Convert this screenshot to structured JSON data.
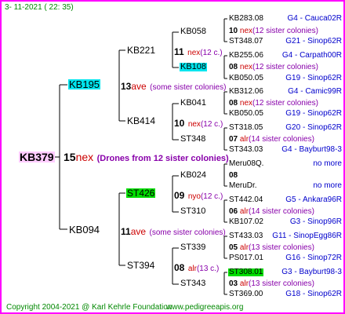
{
  "header": {
    "timestamp": "3- 11-2021 ( 22: 35)"
  },
  "footer": {
    "copyright": "Copyright 2004-2021 @ Karl Kehrle Foundation",
    "url": "www.pedigreeapis.org"
  },
  "root": {
    "id": "KB379",
    "gen_num": "15",
    "gen_suffix": "nex",
    "note": "(Drones from 12 sister colonies)"
  },
  "parents": [
    {
      "id": "KB195",
      "gen_num": "13",
      "gen_suffix": "ave",
      "note": "(some sister colonies)"
    },
    {
      "id": "KB094",
      "gen_num": "11",
      "gen_suffix": "ave",
      "note": "(some sister colonies)"
    }
  ],
  "gp": [
    {
      "id": "KB221",
      "gen_num": "11",
      "gen_suffix": "nex",
      "note": "(12 c.)"
    },
    {
      "id": "KB414",
      "gen_num": "10",
      "gen_suffix": "nex",
      "note": "(12 c.)"
    },
    {
      "id": "ST426",
      "gen_num": "09",
      "gen_suffix": "nyo",
      "note": "(12 c.)"
    },
    {
      "id": "ST394",
      "gen_num": "08",
      "gen_suffix": "alr",
      "note": "(13 c.)"
    }
  ],
  "ggp": [
    {
      "id": "KB058",
      "gen_num": "10",
      "gen_suffix": "nex",
      "note": "(12 sister colonies)"
    },
    {
      "id": "KB108",
      "gen_num": "08",
      "gen_suffix": "nex",
      "note": "(12 sister colonies)"
    },
    {
      "id": "KB041",
      "gen_num": "08",
      "gen_suffix": "nex",
      "note": "(12 sister colonies)"
    },
    {
      "id": "ST348",
      "gen_num": "07",
      "gen_suffix": "alr",
      "note": "(14 sister colonies)"
    },
    {
      "id": "KB024",
      "gen_num": "08",
      "gen_suffix": "",
      "note": ""
    },
    {
      "id": "ST310",
      "gen_num": "06",
      "gen_suffix": "alr",
      "note": "(14 sister colonies)"
    },
    {
      "id": "ST339",
      "gen_num": "05",
      "gen_suffix": "alr",
      "note": "(13 sister colonies)"
    },
    {
      "id": "ST343",
      "gen_num": "03",
      "gen_suffix": "alr",
      "note": "(13 sister colonies)"
    }
  ],
  "g4": [
    {
      "id": "KB283.08",
      "info": "G4 - Cauca02R"
    },
    {
      "id": "ST348.07",
      "info": "G21 - Sinop62R"
    },
    {
      "id": "KB255.06",
      "info": "G4 - Carpath00R"
    },
    {
      "id": "KB050.05",
      "info": "G19 - Sinop62R"
    },
    {
      "id": "KB312.06",
      "info": "G4 - Camic99R"
    },
    {
      "id": "KB050.05",
      "info": "G19 - Sinop62R"
    },
    {
      "id": "ST318.05",
      "info": "G20 - Sinop62R"
    },
    {
      "id": "ST343.03",
      "info": "G4 - Bayburt98-3"
    },
    {
      "id": "Meru08Q.",
      "info": "no more"
    },
    {
      "id": "MeruDr.",
      "info": "no more"
    },
    {
      "id": "ST442.04",
      "info": "G5 - Ankara96R"
    },
    {
      "id": "KB107.02",
      "info": "G3 - Sinop96R"
    },
    {
      "id": "ST433.03",
      "info": "G11 - SinopEgg86R"
    },
    {
      "id": "PS017.01",
      "info": "G16 - Sinop72R"
    },
    {
      "id": "ST308.01",
      "info": "G3 - Bayburt98-3"
    },
    {
      "id": "ST369.00",
      "info": "G18 - Sinop62R"
    }
  ],
  "colors": {
    "border": "#ff00ff",
    "lines": "#000000",
    "gen_red": "#cc0000",
    "note_purple": "#8800aa",
    "info_blue": "#0000cc",
    "footer_green": "#008800",
    "hl_cyan": "#00e5ee",
    "hl_green": "#00dd00",
    "hl_pink": "#ffccff"
  }
}
